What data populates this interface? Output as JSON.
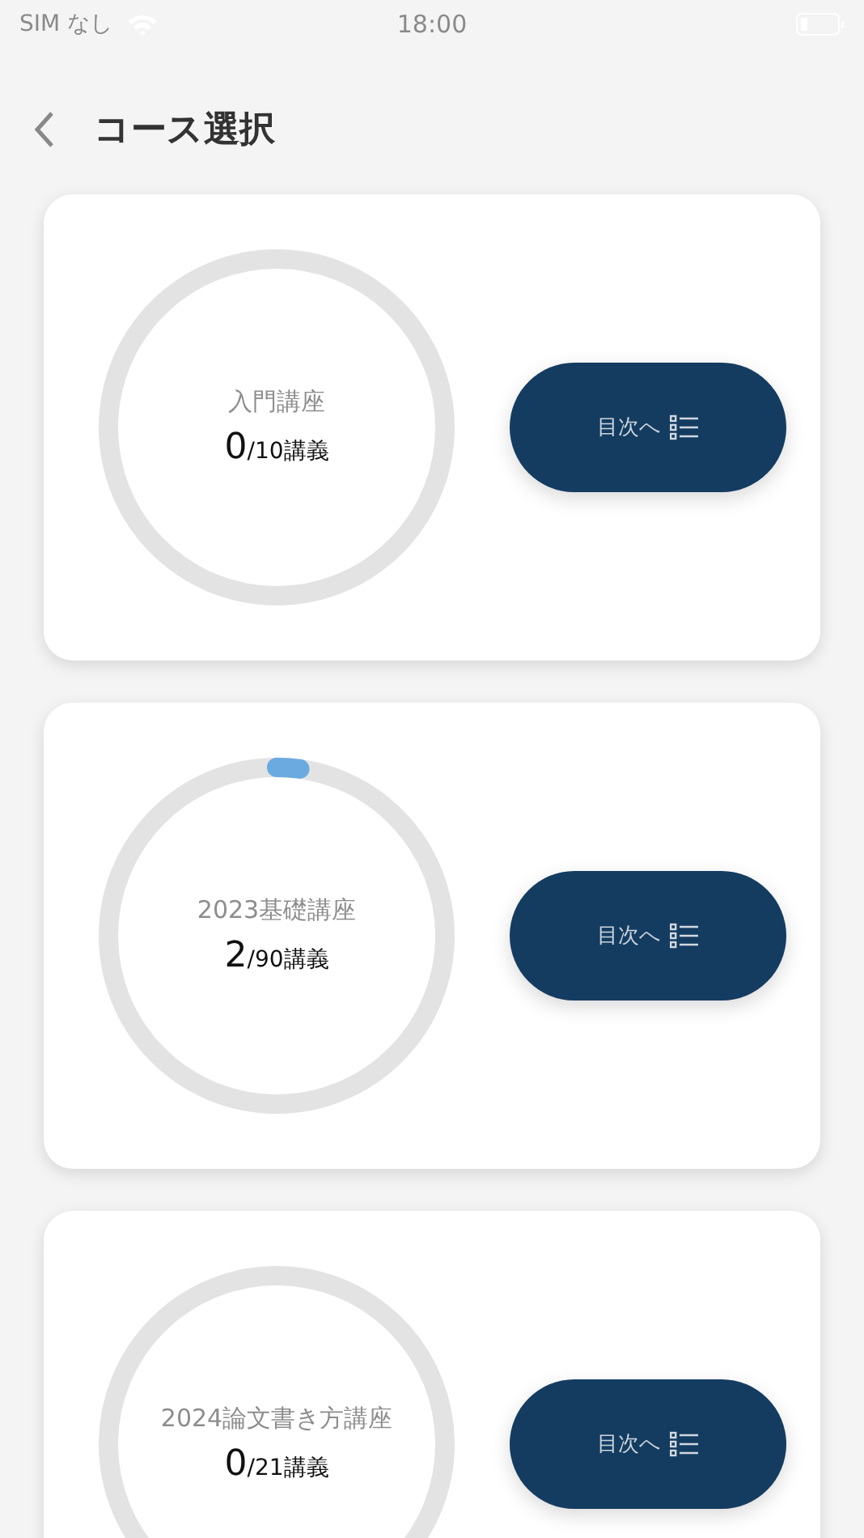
{
  "status_bar": {
    "carrier": "SIM なし",
    "time": "18:00"
  },
  "header": {
    "title": "コース選択"
  },
  "courses": [
    {
      "name": "入門講座",
      "done": "0",
      "total": "/10講義",
      "level": 0,
      "button": "目次へ"
    },
    {
      "name": "2023基礎講座",
      "done": "2",
      "total": "/90講義",
      "level": 0.022,
      "button": "目次へ"
    },
    {
      "name": "2024論文書き方講座",
      "done": "0",
      "total": "/21講義",
      "level": 0,
      "button": "目次へ"
    }
  ]
}
